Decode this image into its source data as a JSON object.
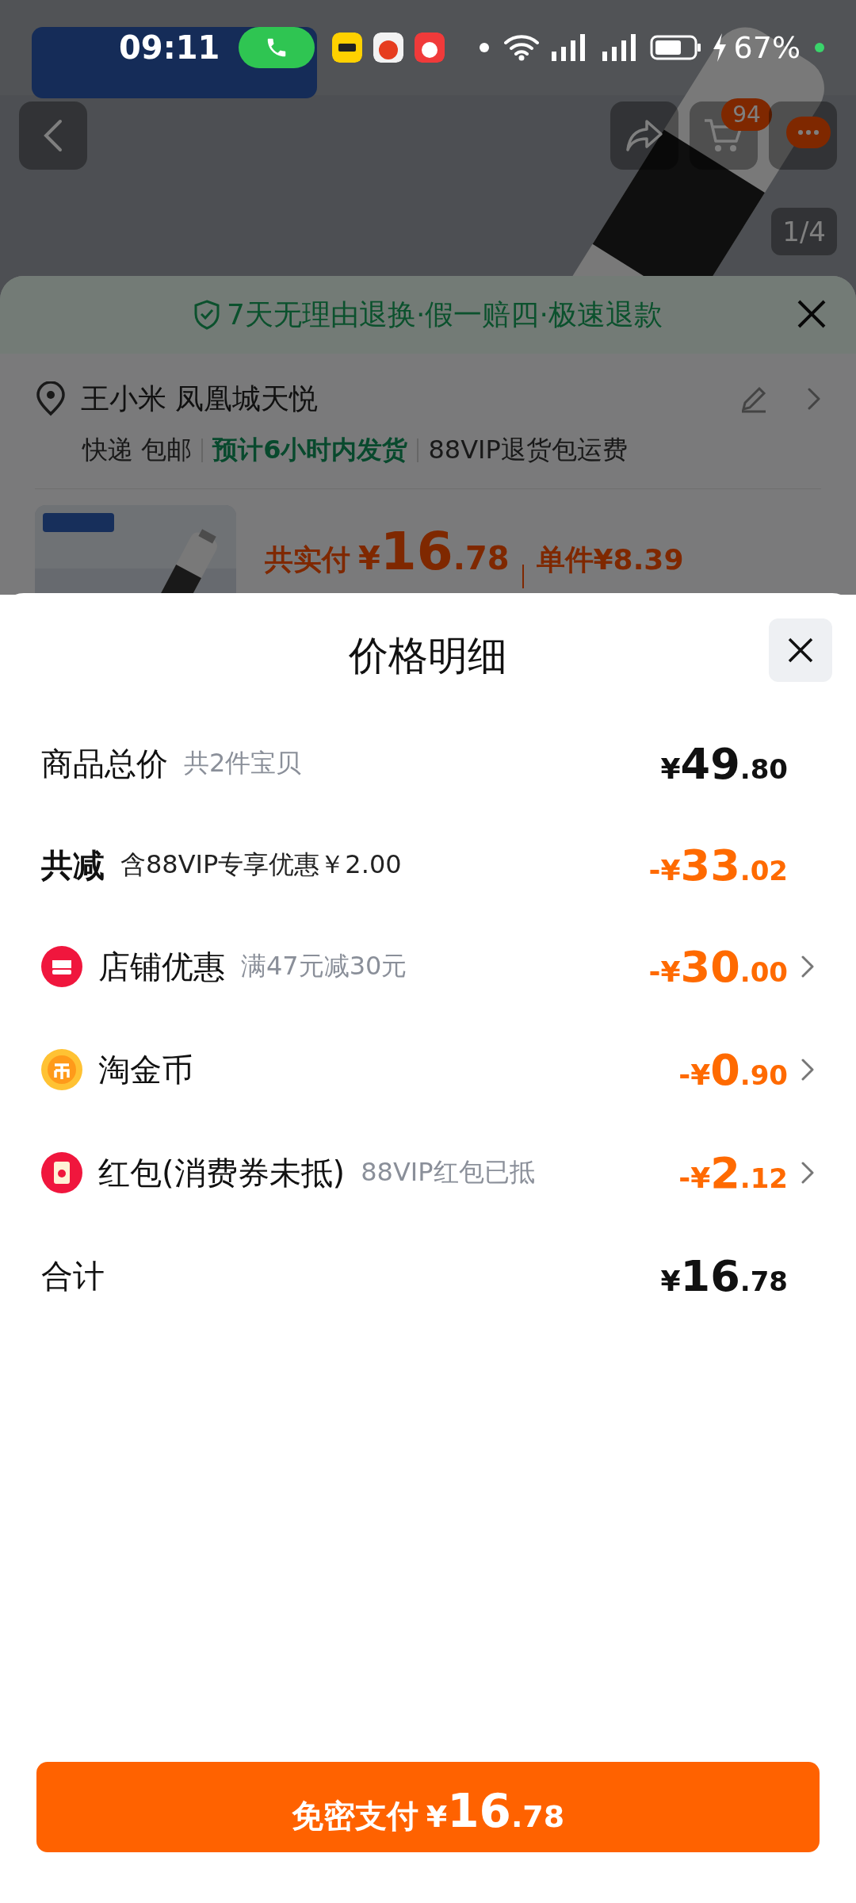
{
  "status_bar": {
    "time": "09:11",
    "battery": "67%"
  },
  "product_header": {
    "image_counter": "1/4",
    "cart_badge": "94"
  },
  "order_sheet": {
    "guarantee": "7天无理由退换·假一赔四·极速退款",
    "address": "王小米 凤凰城天悦",
    "delivery": [
      {
        "text": "快递 包邮",
        "kind": "plain"
      },
      {
        "text": "预计6小时内发货",
        "kind": "highlight"
      },
      {
        "text": "88VIP退货包运费",
        "kind": "plain"
      }
    ],
    "total_label": "共实付",
    "total_amount": "¥16.78",
    "unit_price": "单件¥8.39"
  },
  "price_sheet": {
    "title": "价格明细",
    "rows": [
      {
        "kind": "plain",
        "label": "商品总价",
        "note": "共2件宝贝",
        "amount": "¥49.80",
        "color": "#111111",
        "chevron": false,
        "strong": false
      },
      {
        "kind": "plain",
        "label": "共减",
        "note": "含88VIP专享优惠￥2.00",
        "amount": "-¥33.02",
        "color": "#ff6a00",
        "chevron": false,
        "strong": true
      },
      {
        "kind": "shop",
        "label": "店铺优惠",
        "note": "满47元减30元",
        "amount": "-¥30.00",
        "color": "#ff6a00",
        "chevron": true,
        "strong": false
      },
      {
        "kind": "coin",
        "label": "淘金币",
        "amount": "-¥0.90",
        "color": "#ff6a00",
        "chevron": true,
        "strong": false
      },
      {
        "kind": "envelope",
        "label": "红包(消费券未抵)",
        "note": "88VIP红包已抵",
        "amount": "-¥2.12",
        "color": "#ff6a00",
        "chevron": true,
        "strong": false
      },
      {
        "kind": "plain",
        "label": "合计",
        "amount": "¥16.78",
        "color": "#111111",
        "chevron": false,
        "strong": false
      }
    ],
    "pay_label": "免密支付",
    "pay_amount": "¥16.78"
  }
}
